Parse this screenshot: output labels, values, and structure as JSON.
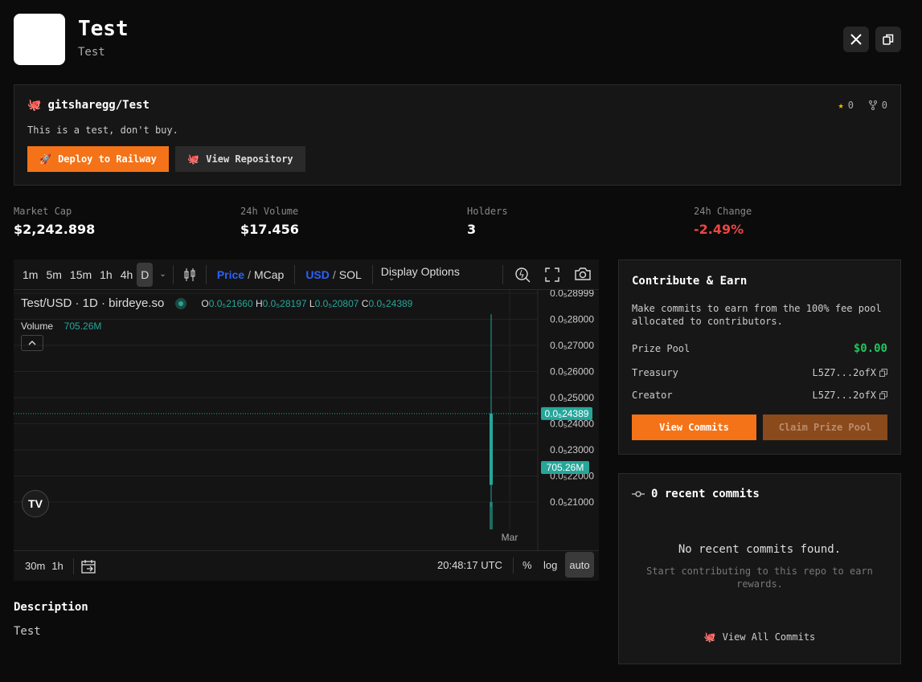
{
  "header": {
    "title": "Test",
    "subtitle": "Test"
  },
  "repo": {
    "name": "gitsharegg/Test",
    "description": "This is a test, don't buy.",
    "stars": "0",
    "forks": "0",
    "deploy_label": "Deploy to Railway",
    "view_repo_label": "View Repository"
  },
  "stats": [
    {
      "label": "Market Cap",
      "value": "$2,242.898"
    },
    {
      "label": "24h Volume",
      "value": "$17.456"
    },
    {
      "label": "Holders",
      "value": "3"
    },
    {
      "label": "24h Change",
      "value": "-2.49%"
    }
  ],
  "chart_toolbar": {
    "intervals": [
      "1m",
      "5m",
      "15m",
      "1h",
      "4h",
      "D"
    ],
    "price": "Price",
    "mcap": "MCap",
    "usd": "USD",
    "sol": "SOL",
    "display_options": "Display Options"
  },
  "chart_data": {
    "type": "candlestick",
    "symbol": "Test/USD · 1D · birdeye.so",
    "ohlc": {
      "O": "0.0₅21660",
      "H": "0.0₅28197",
      "L": "0.0₅20807",
      "C": "0.0₅24389"
    },
    "volume_label": "Volume",
    "volume_value": "705.26M",
    "y_ticks": [
      "0.0₅28999",
      "0.0₅28000",
      "0.0₅27000",
      "0.0₅26000",
      "0.0₅25000",
      "0.0₅24000",
      "0.0₅23000",
      "0.0₅22000",
      "0.0₅21000"
    ],
    "current_price_label": "0.0₅24389",
    "x_label": "Mar",
    "candle": {
      "open": 21660,
      "high": 28197,
      "low": 20807,
      "close": 24389
    }
  },
  "chart_footer": {
    "ranges": [
      "30m",
      "1h"
    ],
    "time": "20:48:17 UTC",
    "percent": "%",
    "log": "log",
    "auto": "auto"
  },
  "description": {
    "heading": "Description",
    "text": "Test"
  },
  "contribute": {
    "title": "Contribute & Earn",
    "text": "Make commits to earn from the 100% fee pool allocated to contributors.",
    "prize_pool_label": "Prize Pool",
    "prize_pool_value": "$0.00",
    "treasury_label": "Treasury",
    "treasury_value": "L5Z7...2ofX",
    "creator_label": "Creator",
    "creator_value": "L5Z7...2ofX",
    "view_commits": "View Commits",
    "claim_prize": "Claim Prize Pool"
  },
  "commits": {
    "title": "0 recent commits",
    "empty_title": "No recent commits found.",
    "empty_text": "Start contributing to this repo to earn rewards.",
    "view_all": "View All Commits"
  },
  "colors": {
    "accent": "#f47318",
    "green": "#22c55e",
    "red": "#ef4444",
    "candle": "#26a69a"
  }
}
